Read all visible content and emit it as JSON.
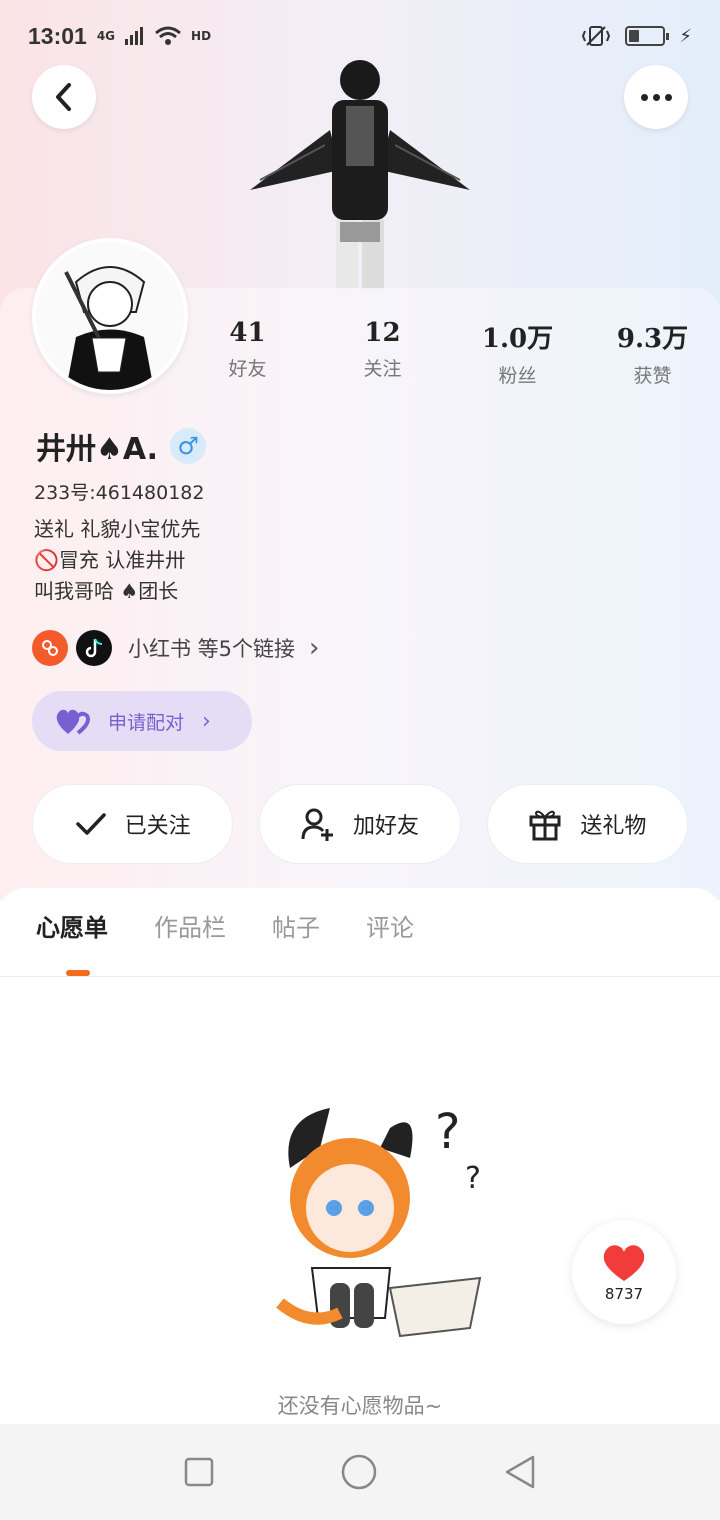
{
  "status_bar": {
    "time": "13:01",
    "network": "4G",
    "hd": "HD"
  },
  "profile": {
    "stats": [
      {
        "value": "41",
        "label": "好友"
      },
      {
        "value": "12",
        "label": "关注"
      },
      {
        "value": "1.0万",
        "label": "粉丝"
      },
      {
        "value": "9.3万",
        "label": "获赞"
      }
    ],
    "nickname": "井卅♠A.",
    "gender_symbol": "♂",
    "uid": "233号:461480182",
    "bio_lines": [
      "送礼 礼貌小宝优先",
      "🚫冒充 认准井卅",
      "叫我哥哈 ♠团长"
    ],
    "links_text": "小红书 等5个链接",
    "pair_button": "申请配对"
  },
  "actions": {
    "followed": "已关注",
    "add_friend": "加好友",
    "send_gift": "送礼物"
  },
  "tabs": [
    "心愿单",
    "作品栏",
    "帖子",
    "评论"
  ],
  "empty_state": "还没有心愿物品~",
  "like_fab": {
    "count": "8737"
  },
  "colors": {
    "accent_orange": "#f36b1c",
    "pair_purple": "#7a5fd0",
    "gender_blue": "#3c93e0"
  }
}
